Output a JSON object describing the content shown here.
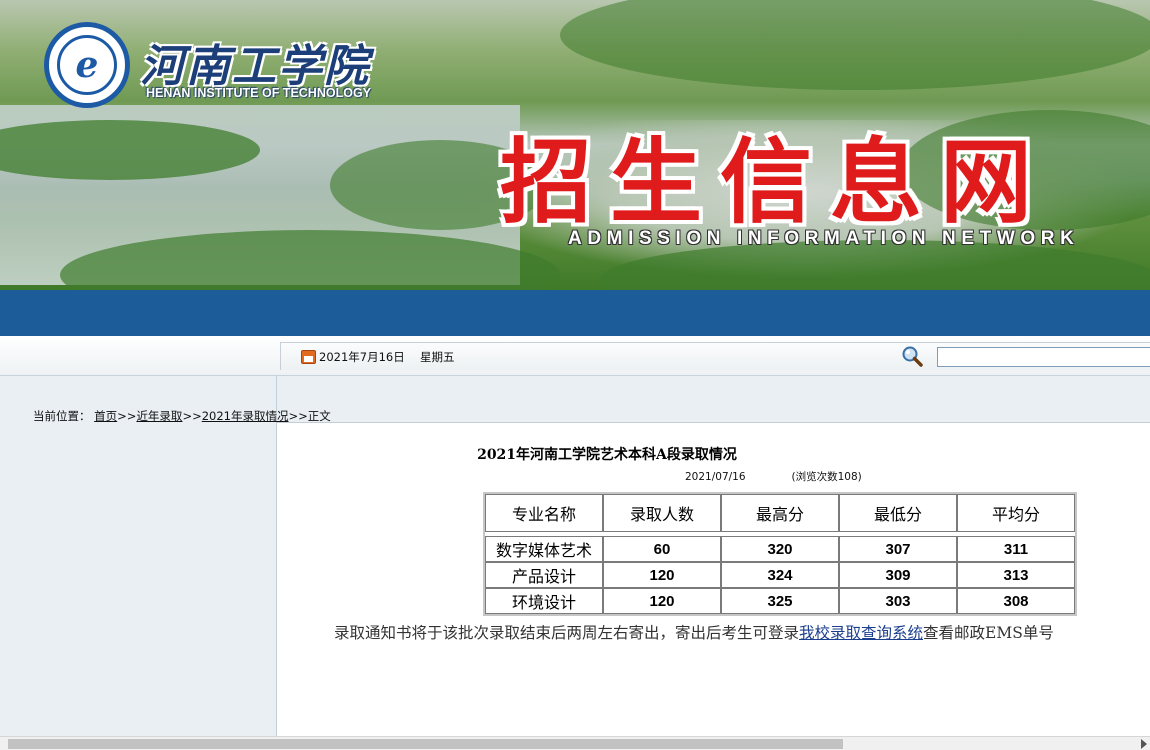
{
  "banner": {
    "school_name": "河南工学院",
    "school_name_en": "HENAN INSTITUTE OF TECHNOLOGY",
    "title": "招生信息网",
    "subtitle": "ADMISSION INFORMATION NETWORK"
  },
  "datebar": {
    "date": "2021年7月16日",
    "weekday": "星期五",
    "search_placeholder": ""
  },
  "breadcrumb": {
    "label": "当前位置：",
    "home": "首页",
    "sep": ">>",
    "level1": "近年录取",
    "level2": "2021年录取情况",
    "current": "正文"
  },
  "article": {
    "title": "2021年河南工学院艺术本科A段录取情况",
    "date": "2021/07/16",
    "views": "(浏览次数108)",
    "table": {
      "headers": [
        "专业名称",
        "录取人数",
        "最高分",
        "最低分",
        "平均分"
      ],
      "rows": [
        [
          "数字媒体艺术",
          "60",
          "320",
          "307",
          "311"
        ],
        [
          "产品设计",
          "120",
          "324",
          "309",
          "313"
        ],
        [
          "环境设计",
          "120",
          "325",
          "303",
          "308"
        ]
      ]
    },
    "notice_before": "录取通知书将于该批次录取结束后两周左右寄出，寄出后考生可登录",
    "notice_link": "我校录取查询系统",
    "notice_after": "查看邮政EMS单号"
  },
  "colors": {
    "nav_blue": "#1c5c99",
    "title_red": "#e01b1b",
    "sidebar_bg": "#e9eff3"
  }
}
